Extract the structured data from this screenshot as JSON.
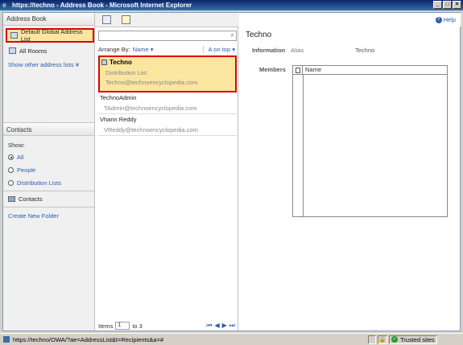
{
  "window": {
    "title": "https://techno - Address Book - Microsoft Internet Explorer",
    "controls": [
      "_",
      "□",
      "×"
    ]
  },
  "left": {
    "header": "Address Book",
    "lists": [
      {
        "label": "Default Global Address List",
        "selected": true
      },
      {
        "label": "All Rooms",
        "selected": false
      }
    ],
    "show_other": "Show other address lists",
    "contacts_header": "Contacts",
    "show_label": "Show:",
    "filters": [
      {
        "label": "All",
        "checked": true
      },
      {
        "label": "People",
        "checked": false
      },
      {
        "label": "Distribution Lists",
        "checked": false
      }
    ],
    "contacts_folder": "Contacts",
    "create_folder": "Create New Folder"
  },
  "middle": {
    "search_placeholder": "",
    "arrange_by": "Arrange By:",
    "arrange_value": "Name",
    "sort_order": "A on top",
    "records": [
      {
        "name": "Techno",
        "type": "Distribution List",
        "email": "Techno@technoencyclopedia.com"
      },
      {
        "name": "TechnoAdmin",
        "email": "TAdmin@technoencyclopedia.com"
      },
      {
        "name": "Vhann Reddy",
        "email": "VReddy@technoencyclopedia.com"
      }
    ],
    "items_label": "Items",
    "items_from": "1",
    "items_to": "to 3"
  },
  "right": {
    "help": "Help",
    "title": "Techno",
    "info_label": "Information",
    "alias_label": "Alias",
    "alias_value": "Techno",
    "members_label": "Members",
    "members_col": "Name"
  },
  "status": {
    "url": "https://techno/OWA/?ae=AddressList&t=Recipients&a=#",
    "zone": "Trusted sites"
  }
}
